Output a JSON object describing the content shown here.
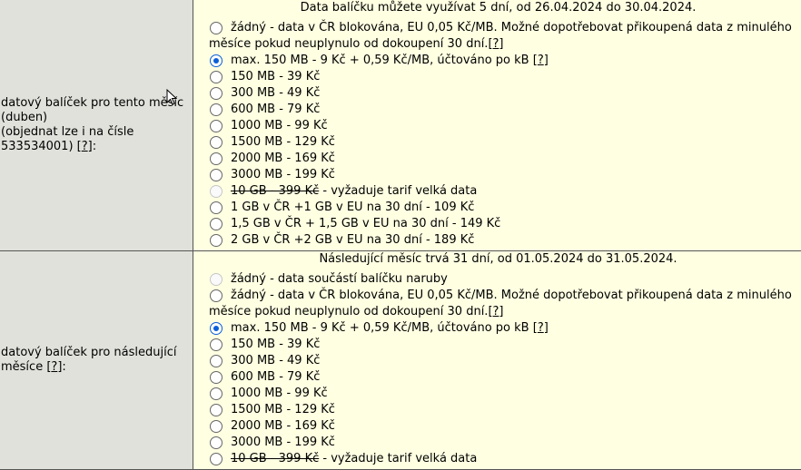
{
  "sections": [
    {
      "label_lines": [
        "datový balíček pro tento měsíc",
        "(duben)",
        "(objednat lze i na čísle",
        "533534001) ["
      ],
      "label_help": "?",
      "label_tail": "]:",
      "header": "Data balíčku můžete využívat 5 dní, od 26.04.2024 do 30.04.2024.",
      "options": [
        {
          "text": "žádný - data v ČR blokována, EU 0,05 Kč/MB. Možné dopotřebovat přikoupená data z minulého",
          "text2": "měsíce pokud neuplynulo od dokoupení 30 dní.",
          "help": "?"
        },
        {
          "text": "max. 150 MB - 9 Kč + 0,59 Kč/MB, účtováno po kB",
          "help": "?"
        },
        {
          "text": "150 MB - 39 Kč"
        },
        {
          "text": "300 MB - 49 Kč"
        },
        {
          "text": "600 MB - 79 Kč"
        },
        {
          "text": "1000 MB - 99 Kč"
        },
        {
          "text": "1500 MB - 129 Kč"
        },
        {
          "text": "2000 MB - 169 Kč"
        },
        {
          "text": "3000 MB - 199 Kč"
        },
        {
          "strike": "10 GB - 399 Kč",
          "text": " - vyžaduje tarif velká data"
        },
        {
          "text": "1 GB v ČR +1 GB v EU na 30 dní - 109 Kč"
        },
        {
          "text": "1,5 GB v ČR + 1,5 GB v EU na 30 dní - 149 Kč"
        },
        {
          "text": "2 GB v ČR +2 GB v EU na 30 dní - 189 Kč"
        }
      ]
    },
    {
      "label_lines": [
        "datový balíček pro následující",
        "měsíce ["
      ],
      "label_help": "?",
      "label_tail": "]:",
      "header": "Následující měsíc trvá 31 dní, od 01.05.2024 do 31.05.2024.",
      "options": [
        {
          "text": "žádný - data součástí balíčku naruby"
        },
        {
          "text": "žádný - data v ČR blokována, EU 0,05 Kč/MB. Možné dopotřebovat přikoupená data z minulého",
          "text2": "měsíce pokud neuplynulo od dokoupení 30 dní.",
          "help": "?"
        },
        {
          "text": "max. 150 MB - 9 Kč + 0,59 Kč/MB, účtováno po kB",
          "help": "?"
        },
        {
          "text": "150 MB - 39 Kč"
        },
        {
          "text": "300 MB - 49 Kč"
        },
        {
          "text": "600 MB - 79 Kč"
        },
        {
          "text": "1000 MB - 99 Kč"
        },
        {
          "text": "1500 MB - 129 Kč"
        },
        {
          "text": "2000 MB - 169 Kč"
        },
        {
          "text": "3000 MB - 199 Kč"
        },
        {
          "strike": "10 GB - 399 Kč",
          "text": " - vyžaduje tarif velká data"
        }
      ]
    }
  ],
  "selected": [
    "max. 150 MB - 9 Kč + 0,59 Kč/MB, účtováno po kB",
    "max. 150 MB - 9 Kč + 0,59 Kč/MB, účtováno po kB"
  ],
  "colors": {
    "label_bg": "#e1e1dc",
    "options_bg": "#ffffe2",
    "radio_checked": "#0a5fd8"
  }
}
